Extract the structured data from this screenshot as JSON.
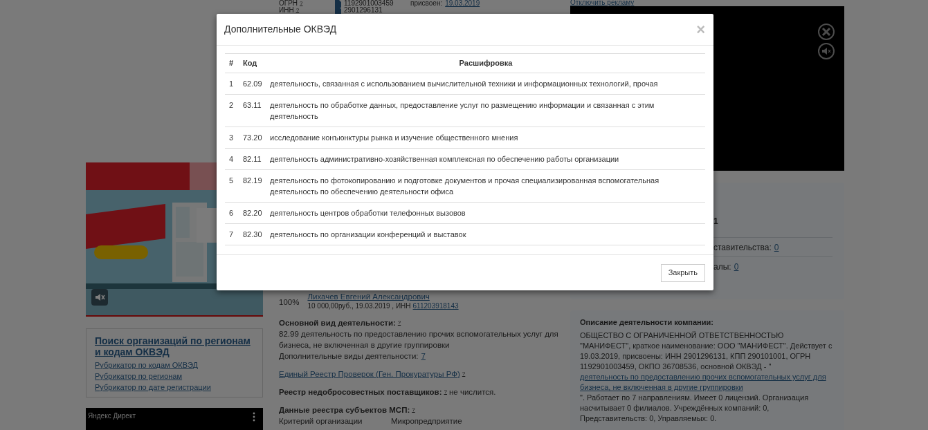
{
  "page": {
    "header_rows": [
      {
        "label": "ОГРН",
        "hint": "?",
        "value": "1192901003459",
        "assigned_label": "присвоен:",
        "assigned_date": "19.03.2019"
      },
      {
        "label": "ИНН",
        "hint": "?",
        "value": "2901296131"
      }
    ],
    "disable_ads_link": "Отключить рекламу",
    "founder": {
      "share": "100%",
      "name": "Лихачев Евгений Александрович",
      "details": "10 000,00руб., 19.03.2019 , ИНН",
      "inn_link": "611203918143"
    },
    "main_activity": {
      "heading": "Основной вид деятельности:",
      "hint": "?",
      "text": "82.99 деятельность по предоставлению прочих вспомогательных услуг для бизнеса, не включенная в другие группировки",
      "additional_label": "Дополнительные виды деятельности:",
      "additional_link": "7"
    },
    "inspections": {
      "link": "Единый Реестр Проверок (Ген. Прокуратуры РФ)",
      "hint": "?"
    },
    "unfair_suppliers": {
      "heading": "Реестр недобросовестных поставщиков:",
      "hint": "?",
      "value": "не числится."
    },
    "sme": {
      "heading": "Данные реестра субъектов МСП:",
      "hint": "?",
      "criterion_label": "Критерий организации",
      "criterion_value": "Микропредприятие"
    },
    "search_box": {
      "title": "Поиск организаций по регионам и кодам ОКВЭД",
      "links": [
        "Рубрикатор по кодам ОКВЭД",
        "Рубрикатор по регионам",
        "Рубрикатор по дате регистрации"
      ]
    },
    "direct_ad": {
      "label": "Яндекс Директ"
    },
    "stats_panel": {
      "bold_fragment": "1",
      "rows": [
        {
          "label": "ставительства:",
          "link": "0"
        },
        {
          "label": "алы:",
          "link": "0"
        }
      ]
    },
    "description": {
      "heading": "Описание деятельности компании:",
      "text_before": "ОБЩЕСТВО С ОГРАНИЧЕННОЙ ОТВЕТСТВЕННОСТЬЮ \"МАНИФЕСТ\", краткое наименование: ООО \"МАНИФЕСТ\". Действует с 19.03.2019, присвоены: ИНН 2901296131, КПП 290101001, ОГРН 1192901003459, ОКПО 36708536, основной ОКВЭД - \"",
      "link": "деятельность по предоставлению прочих вспомогательных услуг для бизнеса, не включенная в другие группировки",
      "text_after": "\". Работает по 7 направлениям. Имеет 0 лицензий. Организация насчитывает 0 филиалов. Учреждённых компаний: 0, Представительств: 0, Управляемых: 0."
    }
  },
  "modal": {
    "title": "Дополнительные ОКВЭД",
    "close": "×",
    "columns": [
      "#",
      "Код",
      "Расшифровка"
    ],
    "rows": [
      {
        "number": "1",
        "code": "62.09",
        "description": "деятельность, связанная с использованием вычислительной техники и информационных технологий, прочая"
      },
      {
        "number": "2",
        "code": "63.11",
        "description": "деятельность по обработке данных, предоставление услуг по размещению информации и связанная с этим деятельность"
      },
      {
        "number": "3",
        "code": "73.20",
        "description": "исследование конъюнктуры рынка и изучение общественного мнения"
      },
      {
        "number": "4",
        "code": "82.11",
        "description": "деятельность административно-хозяйственная комплексная по обеспечению работы организации"
      },
      {
        "number": "5",
        "code": "82.19",
        "description": "деятельность по фотокопированию и подготовке документов и прочая специализированная вспомогательная деятельность по обеспечению деятельности офиса"
      },
      {
        "number": "6",
        "code": "82.20",
        "description": "деятельность центров обработки телефонных вызовов"
      },
      {
        "number": "7",
        "code": "82.30",
        "description": "деятельность по организации конференций и выставок"
      }
    ],
    "button": "Закрыть"
  }
}
